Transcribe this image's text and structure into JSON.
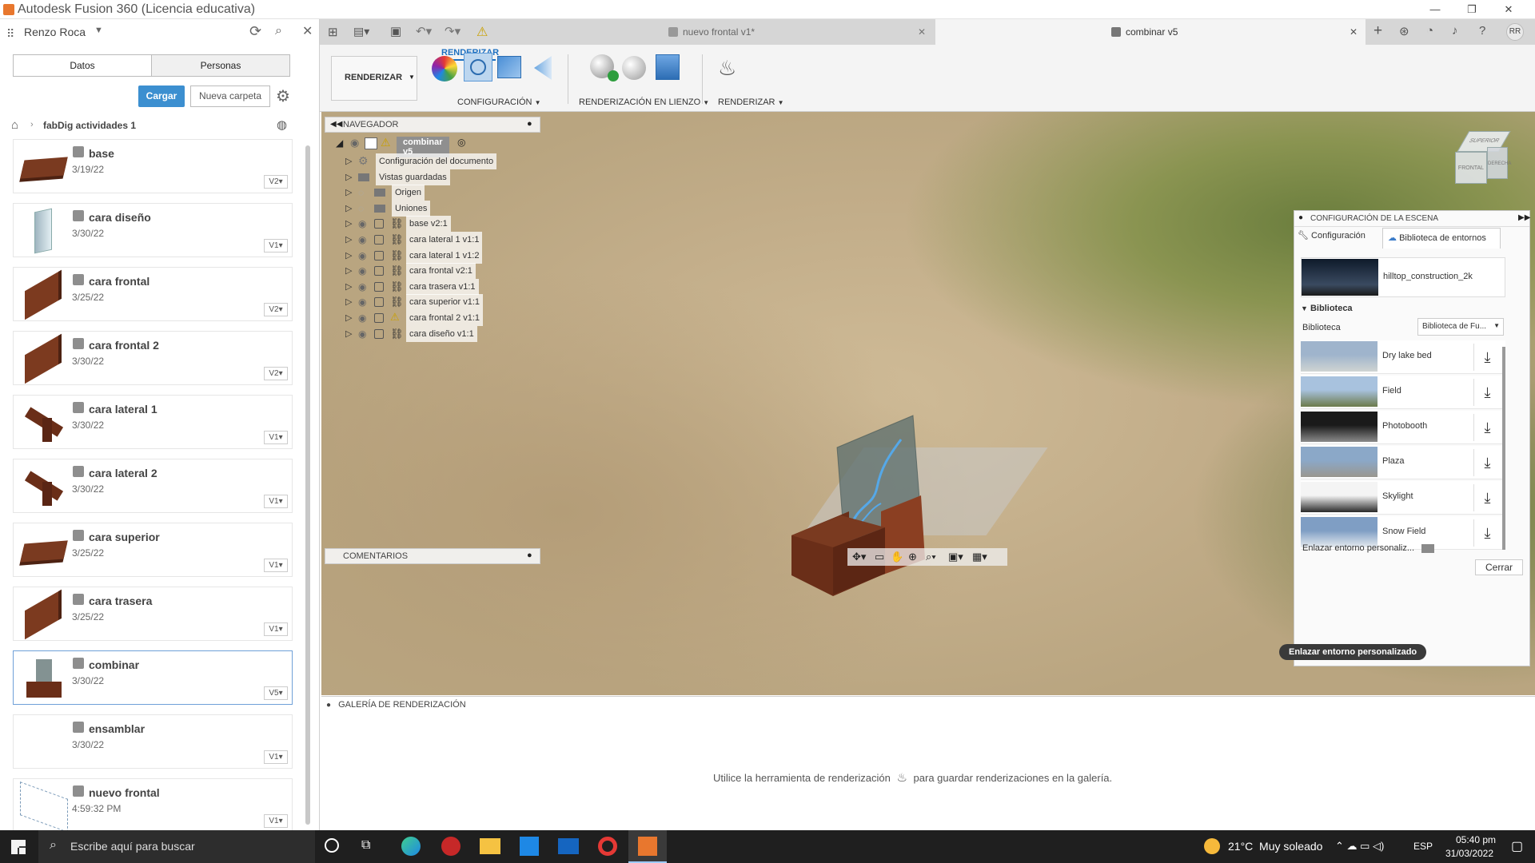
{
  "window": {
    "title": "Autodesk Fusion 360 (Licencia educativa)",
    "controls": [
      "—",
      "❐",
      "✕"
    ]
  },
  "left_panel": {
    "user": "Renzo Roca",
    "tabs": [
      "Datos",
      "Personas"
    ],
    "upload_label": "Cargar",
    "new_folder_label": "Nueva carpeta",
    "breadcrumb": "fabDig actividades 1",
    "items": [
      {
        "name": "base",
        "date": "3/19/22",
        "version": "V2",
        "thumb": "plank"
      },
      {
        "name": "cara diseño",
        "date": "3/30/22",
        "version": "V1",
        "thumb": "glass"
      },
      {
        "name": "cara frontal",
        "date": "3/25/22",
        "version": "V2",
        "thumb": "board"
      },
      {
        "name": "cara frontal 2",
        "date": "3/30/22",
        "version": "V2",
        "thumb": "board"
      },
      {
        "name": "cara lateral 1",
        "date": "3/30/22",
        "version": "V1",
        "thumb": "side"
      },
      {
        "name": "cara lateral 2",
        "date": "3/30/22",
        "version": "V1",
        "thumb": "side"
      },
      {
        "name": "cara superior",
        "date": "3/25/22",
        "version": "V1",
        "thumb": "plank"
      },
      {
        "name": "cara trasera",
        "date": "3/25/22",
        "version": "V1",
        "thumb": "board"
      },
      {
        "name": "combinar",
        "date": "3/30/22",
        "version": "V5",
        "thumb": "combo",
        "selected": true
      },
      {
        "name": "ensamblar",
        "date": "3/30/22",
        "version": "V1",
        "thumb": "none"
      },
      {
        "name": "nuevo frontal",
        "date": "4:59:32 PM",
        "version": "V1",
        "thumb": "sketch"
      }
    ]
  },
  "tabs": {
    "doc1": "nuevo frontal v1*",
    "doc2": "combinar v5",
    "avatar": "RR"
  },
  "toolbar": {
    "workspace_tab": "RENDERIZAR",
    "workspace_dropdown": "RENDERIZAR",
    "group_config": "CONFIGURACIÓN",
    "group_canvas": "RENDERIZACIÓN EN LIENZO",
    "group_render": "RENDERIZAR"
  },
  "navigator": {
    "title": "NAVEGADOR",
    "root": "combinar v5",
    "rows": [
      {
        "label": "Configuración del documento",
        "kind": "gear"
      },
      {
        "label": "Vistas guardadas",
        "kind": "folder"
      },
      {
        "label": "Origen",
        "kind": "folder-hidden"
      },
      {
        "label": "Uniones",
        "kind": "folder-hidden"
      },
      {
        "label": "base v2:1",
        "kind": "comp"
      },
      {
        "label": "cara lateral 1 v1:1",
        "kind": "comp"
      },
      {
        "label": "cara lateral 1 v1:2",
        "kind": "comp"
      },
      {
        "label": "cara frontal v2:1",
        "kind": "comp"
      },
      {
        "label": "cara trasera v1:1",
        "kind": "comp"
      },
      {
        "label": "cara superior v1:1",
        "kind": "comp"
      },
      {
        "label": "cara frontal 2 v1:1",
        "kind": "comp-warn"
      },
      {
        "label": "cara diseño v1:1",
        "kind": "comp"
      }
    ]
  },
  "comments_label": "COMENTARIOS",
  "scene": {
    "title": "CONFIGURACIÓN DE LA ESCENA",
    "tab_config": "Configuración",
    "tab_library": "Biblioteca de entornos",
    "current_env": "hilltop_construction_2k",
    "library_header": "Biblioteca",
    "library_label": "Biblioteca",
    "library_select": "Biblioteca de Fu...",
    "environments": [
      {
        "name": "Dry lake bed",
        "c1": "#9fb4cc",
        "c2": "#cfd4d2"
      },
      {
        "name": "Field",
        "c1": "#a8c2de",
        "c2": "#6b7a4a"
      },
      {
        "name": "Photobooth",
        "c1": "#1a1a1a",
        "c2": "#8a8a8a"
      },
      {
        "name": "Plaza",
        "c1": "#8ba8c8",
        "c2": "#9a978f"
      },
      {
        "name": "Skylight",
        "c1": "#f4f4f4",
        "c2": "#2a2a2a"
      },
      {
        "name": "Snow Field",
        "c1": "#7f9ec4",
        "c2": "#e6ebf0"
      }
    ],
    "link_label": "Enlazar entorno personaliz...",
    "tooltip": "Enlazar entorno personalizado",
    "close_label": "Cerrar"
  },
  "viewcube": {
    "top": "SUPERIOR",
    "front": "FRONTAL",
    "right": "DERECHA"
  },
  "gallery": {
    "title": "GALERÍA DE RENDERIZACIÓN",
    "msg_before": "Utilice la herramienta de renderización",
    "msg_after": "para guardar renderizaciones en la galería."
  },
  "taskbar": {
    "search_placeholder": "Escribe aquí para buscar",
    "weather": "21°C  Muy soleado",
    "lang": "ESP",
    "time": "05:40 pm",
    "date": "31/03/2022"
  }
}
